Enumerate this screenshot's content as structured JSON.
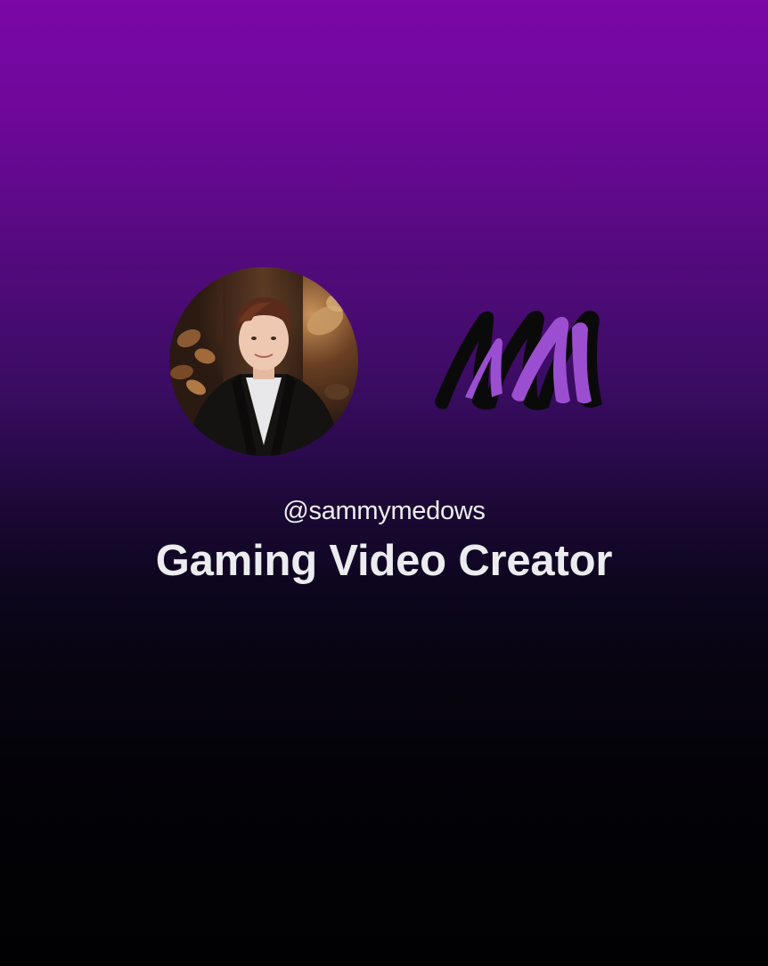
{
  "profile": {
    "handle": "@sammymedows",
    "tagline": "Gaming Video Creator"
  },
  "avatar": {
    "icon": "profile-photo"
  },
  "logo": {
    "icon": "brush-letter-m-logo",
    "colors": {
      "fill": "#9b4fd0",
      "shadow": "#0a0a0a"
    }
  },
  "colors": {
    "background_top": "#7a07a6",
    "background_bottom": "#010103",
    "text": "#ececf0"
  }
}
